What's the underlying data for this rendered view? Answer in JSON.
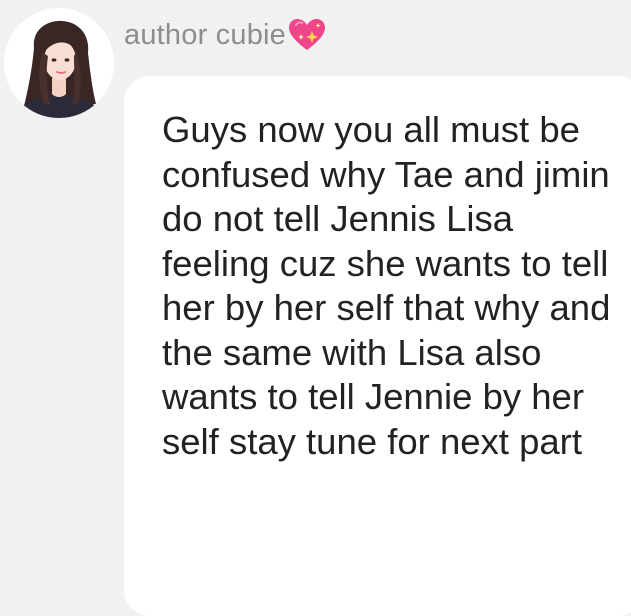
{
  "author": {
    "name": "author cubie",
    "badge_icon": "sparkling-heart-icon",
    "avatar_icon": "girl-avatar-icon"
  },
  "message": {
    "text": "Guys now you all must be confused why Tae and jimin do not tell Jennis Lisa feeling cuz she wants to tell her by her self that why and the same with Lisa also wants to tell Jennie by her self stay tune for next part"
  },
  "colors": {
    "background": "#f1f1f1",
    "bubble": "#ffffff",
    "author_text": "#8d8d8d",
    "message_text": "#222222",
    "heart": "#f0458b"
  }
}
